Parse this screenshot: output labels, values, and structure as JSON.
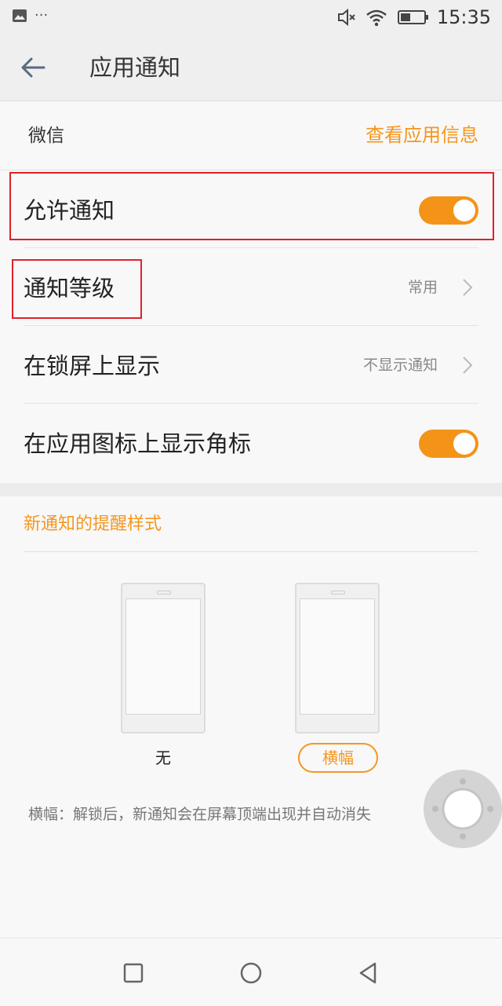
{
  "status_bar": {
    "notification_icon": "image-icon",
    "overflow": "···",
    "mute_icon": "mute-icon",
    "wifi_icon": "wifi-icon",
    "battery_icon": "battery-icon",
    "time": "15:35"
  },
  "header": {
    "title": "应用通知",
    "back_icon": "back-arrow-icon"
  },
  "app": {
    "name": "微信",
    "info_link": "查看应用信息"
  },
  "settings": [
    {
      "label": "允许通知",
      "type": "toggle",
      "on": true
    },
    {
      "label": "通知等级",
      "type": "select",
      "value": "常用"
    },
    {
      "label": "在锁屏上显示",
      "type": "select",
      "value": "不显示通知"
    },
    {
      "label": "在应用图标上显示角标",
      "type": "toggle",
      "on": true
    }
  ],
  "reminder": {
    "title": "新通知的提醒样式",
    "options": [
      {
        "label": "无",
        "selected": false
      },
      {
        "label": "横幅",
        "selected": true
      }
    ],
    "description": "横幅：解锁后，新通知会在屏幕顶端出现并自动消失"
  },
  "nav": {
    "recent_icon": "square-icon",
    "home_icon": "circle-icon",
    "back_icon": "triangle-back-icon"
  },
  "colors": {
    "accent": "#f5961f",
    "toggle_on": "#f39418",
    "highlight": "#e0202a"
  }
}
